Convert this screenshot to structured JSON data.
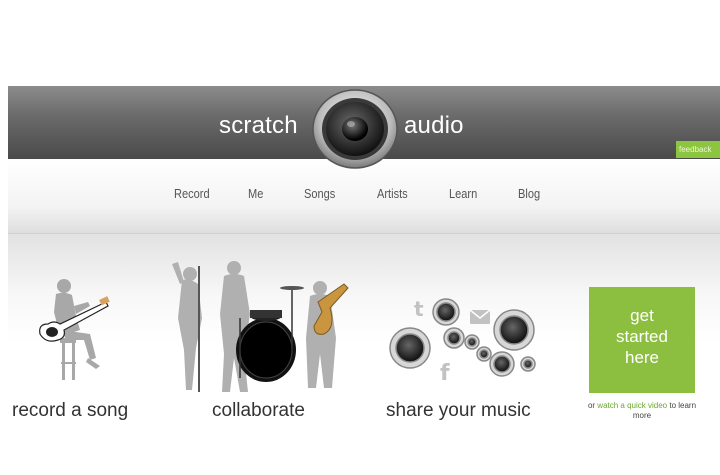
{
  "logo": {
    "left_text": "scratch",
    "right_text": "audio"
  },
  "feedback_label": "feedback",
  "nav": {
    "items": [
      "Record",
      "Me",
      "Songs",
      "Artists",
      "Learn",
      "Blog"
    ]
  },
  "features": [
    {
      "label": "record a song",
      "icon": "guitarist-silhouette"
    },
    {
      "label": "collaborate",
      "icon": "band-silhouette"
    },
    {
      "label": "share your music",
      "icon": "speakers-social-icons"
    }
  ],
  "cta": {
    "label": "get\nstarted\nhere",
    "sub_prefix": "or",
    "sub_link": "watch a quick video",
    "sub_suffix": "to learn more"
  },
  "colors": {
    "header_dark": "#4a4a4a",
    "accent_green": "#8cbf3f",
    "text": "#333333"
  }
}
